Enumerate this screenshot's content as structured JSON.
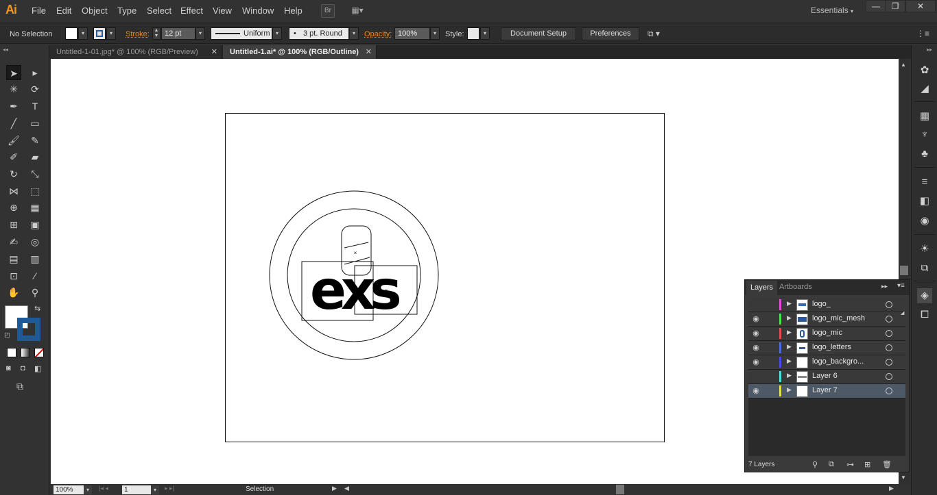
{
  "app": {
    "logo": "Ai"
  },
  "menu": [
    "File",
    "Edit",
    "Object",
    "Type",
    "Select",
    "Effect",
    "View",
    "Window",
    "Help"
  ],
  "menubar_buttons": {
    "bridge": "Br",
    "arrange": "▦▾"
  },
  "workspace": "Essentials",
  "window_controls": {
    "minimize": "—",
    "restore": "❐",
    "close": "✕"
  },
  "control": {
    "selection": "No Selection",
    "stroke_label": "Stroke:",
    "stroke_weight": "12 pt",
    "profile": "Uniform",
    "brush": "3 pt. Round",
    "opacity_label": "Opacity:",
    "opacity_value": "100%",
    "style_label": "Style:",
    "document_setup": "Document Setup",
    "preferences": "Preferences"
  },
  "tabs": [
    {
      "label": "Untitled-1-01.jpg* @ 100% (RGB/Preview)",
      "close": "✕"
    },
    {
      "label": "Untitled-1.ai* @ 100% (RGB/Outline)",
      "close": "✕"
    }
  ],
  "status": {
    "zoom": "100%",
    "artboard": "1",
    "tool": "Selection"
  },
  "layers_panel": {
    "tabs": [
      "Layers",
      "Artboards"
    ],
    "layers": [
      {
        "name": "logo_",
        "color": "#e24bd6",
        "visible": false,
        "selected": false
      },
      {
        "name": "logo_mic_mesh",
        "color": "#4be04b",
        "visible": true,
        "selected": false
      },
      {
        "name": "logo_mic",
        "color": "#e04b4b",
        "visible": true,
        "selected": false
      },
      {
        "name": "logo_letters",
        "color": "#4b6be0",
        "visible": true,
        "selected": false
      },
      {
        "name": "logo_backgro...",
        "color": "#4b4be0",
        "visible": true,
        "selected": false
      },
      {
        "name": "Layer 6",
        "color": "#4be0e0",
        "visible": false,
        "selected": false
      },
      {
        "name": "Layer 7",
        "color": "#e0e04b",
        "visible": true,
        "selected": true
      }
    ],
    "count_label": "7 Layers"
  },
  "artwork_text": "exs"
}
